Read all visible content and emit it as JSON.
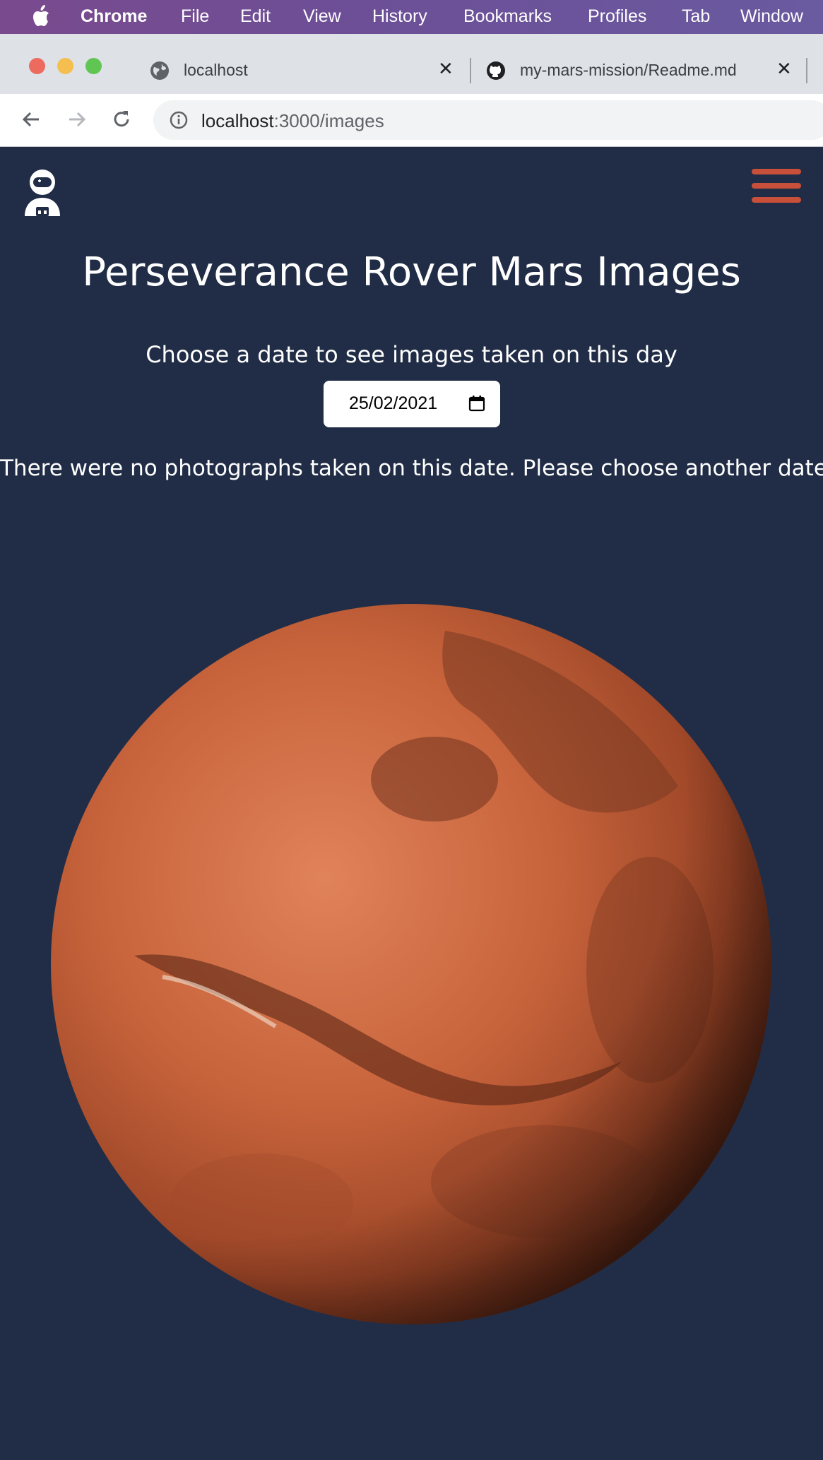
{
  "menubar": {
    "app": "Chrome",
    "items": [
      "File",
      "Edit",
      "View",
      "History",
      "Bookmarks",
      "Profiles",
      "Tab",
      "Window"
    ]
  },
  "tabs": [
    {
      "title": "localhost",
      "icon": "globe-icon",
      "active": true
    },
    {
      "title": "my-mars-mission/Readme.md",
      "icon": "github-icon",
      "active": false
    }
  ],
  "address_bar": {
    "host": "localhost",
    "path": ":3000/images"
  },
  "page": {
    "title": "Perseverance Rover Mars Images",
    "prompt": "Choose a date to see images taken on this day",
    "date_value": "25/02/2021",
    "message": "There were no photographs taken on this date. Please choose another date"
  },
  "colors": {
    "page_background": "#212d46",
    "accent": "#c8503a",
    "mars": "#c0603a"
  }
}
